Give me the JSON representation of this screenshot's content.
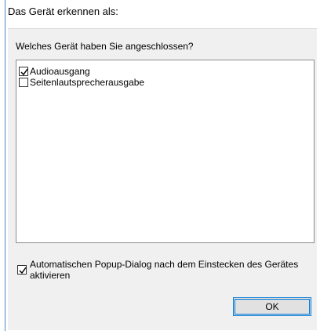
{
  "dialog": {
    "title": "Das Gerät erkennen als:",
    "question": "Welches Gerät haben Sie angeschlossen?",
    "devices": [
      {
        "label": "Audioausgang",
        "checked": true
      },
      {
        "label": "Seitenlautsprecherausgabe",
        "checked": false
      }
    ],
    "auto_popup": {
      "label": "Automatischen Popup-Dialog nach dem Einstecken des Gerätes aktivieren",
      "checked": true
    },
    "ok_label": "OK"
  },
  "colors": {
    "accent": "#0078d7",
    "panel_bg": "#f0f0f0",
    "window_border": "#4a88c9"
  },
  "icons": [
    "checkbox-checked-icon",
    "checkbox-unchecked-icon"
  ]
}
